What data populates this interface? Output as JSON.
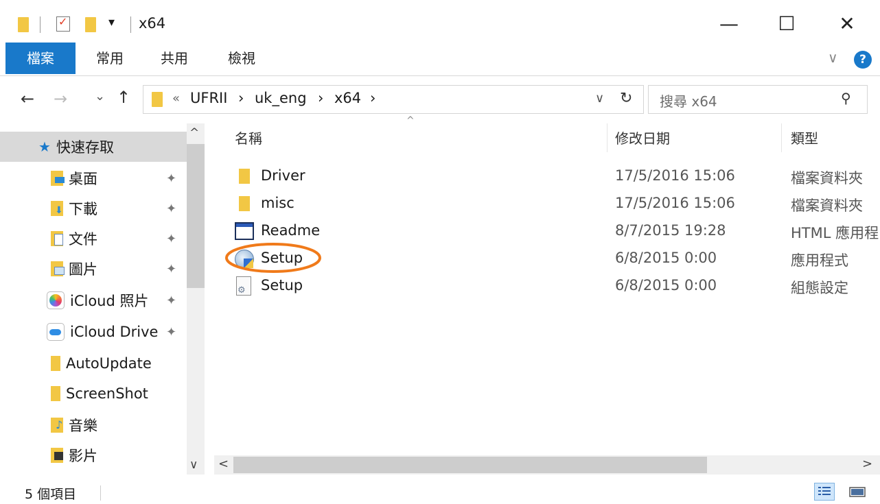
{
  "window": {
    "title": "x64",
    "minimize_glyph": "—",
    "maximize_glyph": "☐",
    "close_glyph": "✕"
  },
  "quick_access": {
    "dropdown_glyph": "▾"
  },
  "ribbon": {
    "tabs": [
      "檔案",
      "常用",
      "共用",
      "檢視"
    ],
    "expand_glyph": "∨",
    "help_glyph": "?"
  },
  "nav": {
    "back_glyph": "←",
    "forward_glyph": "→",
    "recent_glyph": "⌄",
    "up_glyph": "↑",
    "breadcrumb_lead": "«",
    "breadcrumb": [
      "UFRII",
      "uk_eng",
      "x64"
    ],
    "crumb_sep": "›",
    "addr_dropdown_glyph": "∨",
    "refresh_glyph": "↻",
    "search_placeholder": "搜尋 x64",
    "search_glyph": "⚲"
  },
  "sidebar": {
    "items": [
      {
        "label": "快速存取",
        "icon": "star-icon",
        "pinned": false,
        "selected": true
      },
      {
        "label": "桌面",
        "icon": "desktop-folder-icon",
        "pinned": true
      },
      {
        "label": "下載",
        "icon": "downloads-folder-icon",
        "pinned": true
      },
      {
        "label": "文件",
        "icon": "documents-folder-icon",
        "pinned": true
      },
      {
        "label": "圖片",
        "icon": "pictures-folder-icon",
        "pinned": true
      },
      {
        "label": "iCloud 照片",
        "icon": "icloud-photos-icon",
        "pinned": true
      },
      {
        "label": "iCloud Drive",
        "icon": "icloud-drive-icon",
        "pinned": true
      },
      {
        "label": "AutoUpdate",
        "icon": "folder-icon",
        "pinned": false
      },
      {
        "label": "ScreenShot",
        "icon": "folder-icon",
        "pinned": false
      },
      {
        "label": "音樂",
        "icon": "music-folder-icon",
        "pinned": false
      },
      {
        "label": "影片",
        "icon": "videos-folder-icon",
        "pinned": false
      }
    ],
    "pin_glyph": "📌",
    "scroll_up_glyph": "^",
    "scroll_down_glyph": "∨"
  },
  "file_list": {
    "columns": [
      "名稱",
      "修改日期",
      "類型"
    ],
    "sort_glyph": "^",
    "files": [
      {
        "name": "Driver",
        "date": "17/5/2016 15:06",
        "type": "檔案資料夾",
        "icon": "folder-icon"
      },
      {
        "name": "misc",
        "date": "17/5/2016 15:06",
        "type": "檔案資料夾",
        "icon": "folder-icon"
      },
      {
        "name": "Readme",
        "date": "8/7/2015 19:28",
        "type": "HTML 應用程",
        "icon": "html-application-icon"
      },
      {
        "name": "Setup",
        "date": "6/8/2015 0:00",
        "type": "應用程式",
        "icon": "setup-installer-icon"
      },
      {
        "name": "Setup",
        "date": "6/8/2015 0:00",
        "type": "組態設定",
        "icon": "config-file-icon"
      }
    ],
    "highlight_color": "#f07a1a",
    "scroll_left_glyph": "<",
    "scroll_right_glyph": ">"
  },
  "status": {
    "item_count": "5 個項目"
  },
  "colors": {
    "accent": "#1979ca",
    "folder": "#f2c744"
  }
}
